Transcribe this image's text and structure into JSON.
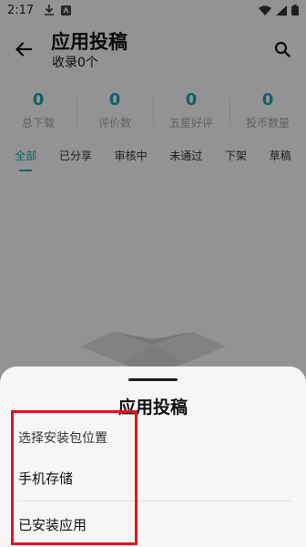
{
  "status_bar": {
    "time": "2:17"
  },
  "header": {
    "title": "应用投稿",
    "subtitle": "收录0个"
  },
  "stats": [
    {
      "value": "0",
      "label": "总下载"
    },
    {
      "value": "0",
      "label": "评价数"
    },
    {
      "value": "0",
      "label": "五星好评"
    },
    {
      "value": "0",
      "label": "投币数量"
    }
  ],
  "tabs": [
    {
      "label": "全部"
    },
    {
      "label": "已分享"
    },
    {
      "label": "审核中"
    },
    {
      "label": "未通过"
    },
    {
      "label": "下架"
    },
    {
      "label": "草稿"
    }
  ],
  "sheet": {
    "title": "应用投稿",
    "prompt": "选择安装包位置",
    "options": [
      {
        "label": "手机存储"
      },
      {
        "label": "已安装应用"
      }
    ]
  },
  "colors": {
    "accent": "#1aa3a3",
    "highlight": "#e21616"
  }
}
